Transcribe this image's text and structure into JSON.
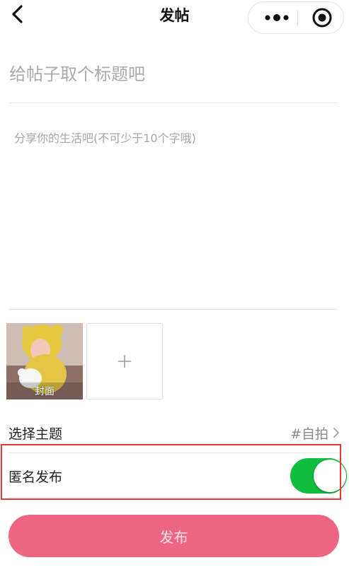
{
  "nav": {
    "title": "发帖",
    "back_icon": "chevron-left-icon",
    "more_icon": "more-dots-icon",
    "close_icon": "target-circle-icon"
  },
  "form": {
    "title_placeholder": "给帖子取个标题吧",
    "content_placeholder": "分享你的生活吧(不可少于10个字哦)"
  },
  "media": {
    "cover_label": "封面",
    "add_icon": "plus-icon"
  },
  "topic": {
    "label": "选择主题",
    "value": "#自拍"
  },
  "anonymous": {
    "label": "匿名发布",
    "enabled": true,
    "switch_color": "#0fbe3c"
  },
  "publish": {
    "label": "发布",
    "color": "#ee6581"
  },
  "highlight_color": "#e53935"
}
